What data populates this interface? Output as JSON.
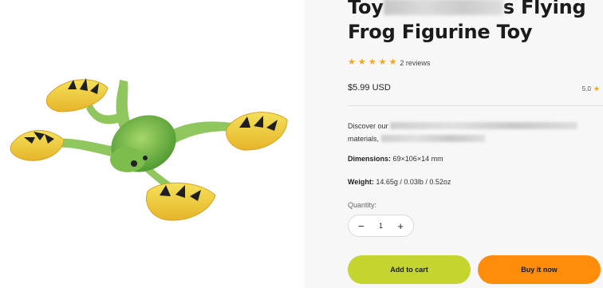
{
  "product": {
    "title_part1": "Toy",
    "title_part2": "s Flying",
    "title_line2": "Frog Figurine Toy",
    "image_alt": "flying-frog-figurine"
  },
  "rating": {
    "stars": 5,
    "reviews_label": "2 reviews",
    "score": "5.0"
  },
  "price": "$5.99 USD",
  "description": {
    "line1_prefix": "Discover our",
    "line2_prefix": "materials,"
  },
  "specs": {
    "dimensions_label": "Dimensions:",
    "dimensions_value": "69×106×14 mm",
    "weight_label": "Weight:",
    "weight_value": "14.65g / 0.03lb / 0.52oz"
  },
  "quantity": {
    "label": "Quantity:",
    "value": "1",
    "minus": "−",
    "plus": "+"
  },
  "actions": {
    "add_to_cart": "Add to cart",
    "buy_now": "Buy it now"
  },
  "colors": {
    "add_to_cart_bg": "#c3d52e",
    "buy_now_bg": "#ff8c0a",
    "star": "#f6a623"
  }
}
